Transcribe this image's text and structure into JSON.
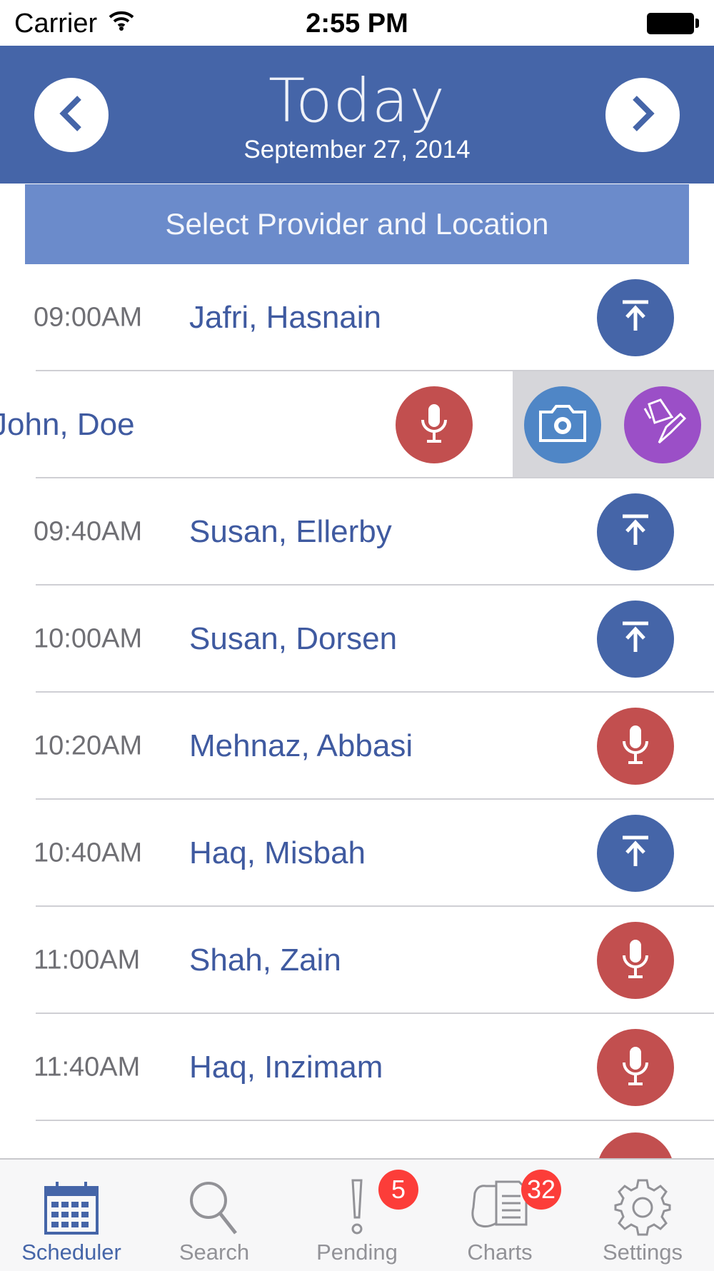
{
  "status_bar": {
    "carrier": "Carrier",
    "time": "2:55 PM"
  },
  "header": {
    "title": "Today",
    "date": "September 27, 2014",
    "prev_icon": "chevron-left-icon",
    "next_icon": "chevron-right-icon"
  },
  "provider_bar": {
    "label": "Select Provider and Location"
  },
  "appointments": [
    {
      "time": "09:00AM",
      "name": "Jafri, Hasnain",
      "action": "upload"
    },
    {
      "time": "",
      "name": "John, Doe",
      "action": "record",
      "swiped": true,
      "swipe_actions": [
        "camera",
        "draw"
      ]
    },
    {
      "time": "09:40AM",
      "name": "Susan, Ellerby",
      "action": "upload"
    },
    {
      "time": "10:00AM",
      "name": "Susan, Dorsen",
      "action": "upload"
    },
    {
      "time": "10:20AM",
      "name": "Mehnaz, Abbasi",
      "action": "record"
    },
    {
      "time": "10:40AM",
      "name": "Haq, Misbah",
      "action": "upload"
    },
    {
      "time": "11:00AM",
      "name": "Shah, Zain",
      "action": "record"
    },
    {
      "time": "11:40AM",
      "name": "Haq, Inzimam",
      "action": "record"
    }
  ],
  "tabs": [
    {
      "label": "Scheduler",
      "icon": "calendar-icon",
      "active": true
    },
    {
      "label": "Search",
      "icon": "search-icon",
      "active": false
    },
    {
      "label": "Pending",
      "icon": "exclamation-icon",
      "active": false,
      "badge": "5"
    },
    {
      "label": "Charts",
      "icon": "charts-icon",
      "active": false,
      "badge": "32"
    },
    {
      "label": "Settings",
      "icon": "gear-icon",
      "active": false
    }
  ],
  "colors": {
    "header": "#4565a8",
    "provider_bar": "#6b8bcb",
    "upload": "#4565a8",
    "record": "#c24f4f",
    "camera": "#4f86c6",
    "draw": "#9b4fc7",
    "badge": "#fc3d39"
  }
}
